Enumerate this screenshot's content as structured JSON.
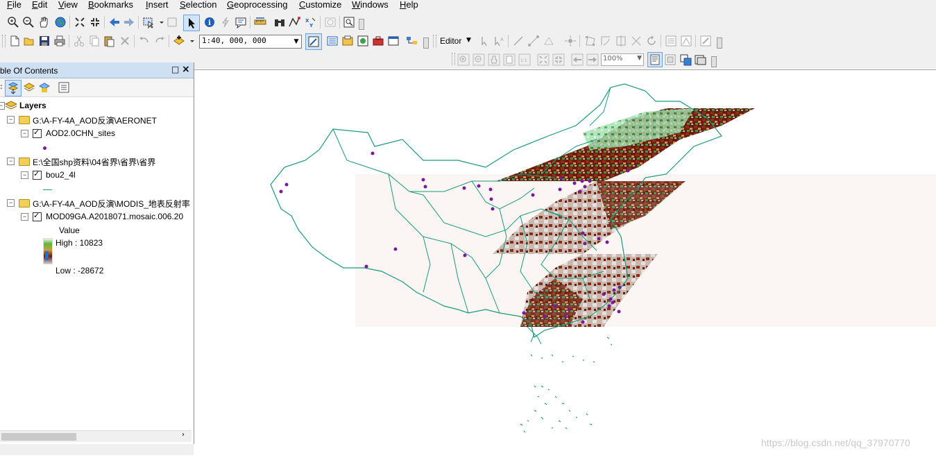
{
  "menu": [
    "File",
    "Edit",
    "View",
    "Bookmarks",
    "Insert",
    "Selection",
    "Geoprocessing",
    "Customize",
    "Windows",
    "Help"
  ],
  "toolbar": {
    "scale": "1:40, 000, 000",
    "editor_label": "Editor",
    "zoom_percent": "100%"
  },
  "toc": {
    "title": "ble Of Contents",
    "root": "Layers",
    "groups": [
      {
        "path": "G:\\A-FY-4A_AOD反演\\AERONET",
        "layer": "AOD2.0CHN_sites"
      },
      {
        "path": "E:\\全国shp资料\\04省界\\省界\\省界",
        "layer": "bou2_4l"
      },
      {
        "path": "G:\\A-FY-4A_AOD反演\\MODIS_地表反射率",
        "layer": "MOD09GA.A2018071.mosaic.006.20"
      }
    ],
    "legend": {
      "value_label": "Value",
      "high": "High : 10823",
      "low": "Low : -28672"
    }
  },
  "map": {
    "watermark": "https://blog.csdn.net/qq_37970770",
    "colors": {
      "boundary": "#1a9a7a",
      "sites": "#7a1a9a",
      "raster_dark": "#6b1a10",
      "raster_green": "#3f9a3a"
    }
  }
}
